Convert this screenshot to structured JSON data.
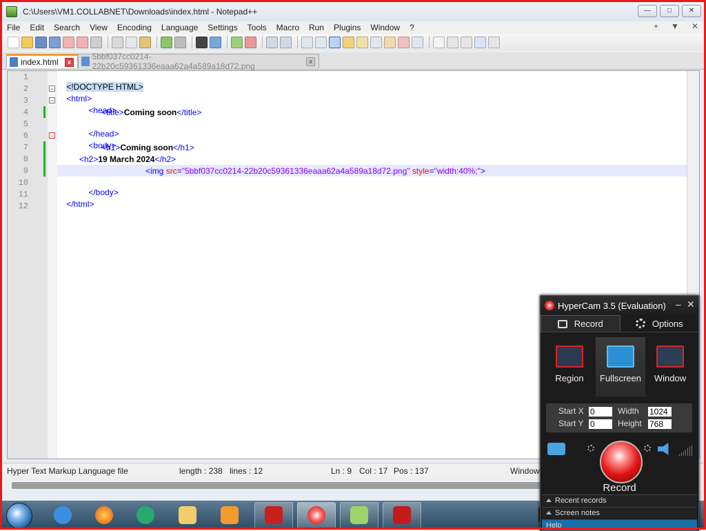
{
  "window": {
    "title": "C:\\Users\\VM1.COLLABNET\\Downloads\\index.html - Notepad++",
    "min": "—",
    "max": "□",
    "close": "✕"
  },
  "menu": {
    "items": [
      "File",
      "Edit",
      "Search",
      "View",
      "Encoding",
      "Language",
      "Settings",
      "Tools",
      "Macro",
      "Run",
      "Plugins",
      "Window",
      "?"
    ],
    "right": [
      "+",
      "▼",
      "✕"
    ]
  },
  "tabs": [
    {
      "label": "index.html",
      "active": true
    },
    {
      "label": "5bbf037cc0214-22b20c59361336eaaa62a4a589a18d72.png",
      "active": false
    }
  ],
  "editor": {
    "lines": [
      {
        "n": "1"
      },
      {
        "n": "2"
      },
      {
        "n": "3"
      },
      {
        "n": "4"
      },
      {
        "n": "5"
      },
      {
        "n": "6"
      },
      {
        "n": "7"
      },
      {
        "n": "8"
      },
      {
        "n": "9"
      },
      {
        "n": "10"
      },
      {
        "n": "11"
      },
      {
        "n": "12"
      }
    ],
    "code": {
      "doctype": "<!DOCTYPE HTML>",
      "html_open": "<html>",
      "head_open": "<head>",
      "title_open": "<title>",
      "title_text": "Coming soon",
      "title_close": "</title>",
      "head_close": "</head>",
      "body_open": "<body>",
      "h1_open": "<h1>",
      "h1_text": "Coming soon",
      "h1_close": "</h1>",
      "h2_open": "<h2>",
      "h2_text": "19 March 2024",
      "h2_close": "</h2>",
      "img_open": "<img ",
      "img_src_attr": "src",
      "img_eq": "=",
      "img_src_val": "\"5bbf037cc0214-22b20c59361336eaaa62a4a589a18d72.png\"",
      "img_style_attr": "style",
      "img_style_val": "\"width:40%;\"",
      "img_end": ">",
      "body_close": "</body>",
      "html_close": "</html>"
    }
  },
  "status": {
    "filetype": "Hyper Text Markup Language file",
    "length": "length : 238",
    "lines": "lines : 12",
    "ln": "Ln : 9",
    "col": "Col : 17",
    "pos": "Pos : 137",
    "eol": "Window"
  },
  "hypercam": {
    "title": "HyperCam 3.5 (Evaluation)",
    "min": "–",
    "close": "✕",
    "tab_record": "Record",
    "tab_options": "Options",
    "mode_region": "Region",
    "mode_fullscreen": "Fullscreen",
    "mode_window": "Window",
    "start_x_label": "Start X",
    "start_y_label": "Start Y",
    "width_label": "Width",
    "height_label": "Height",
    "start_x": "0",
    "start_y": "0",
    "width": "1024",
    "height": "768",
    "record_label": "Record",
    "recent_records": "Recent records",
    "screen_notes": "Screen notes",
    "help": "Help"
  },
  "colors": {
    "tag": "#0000ff",
    "attr": "#ff0000",
    "string": "#8000ff",
    "active_tab_accent": "#f29a2e",
    "record_red": "#e01515"
  }
}
